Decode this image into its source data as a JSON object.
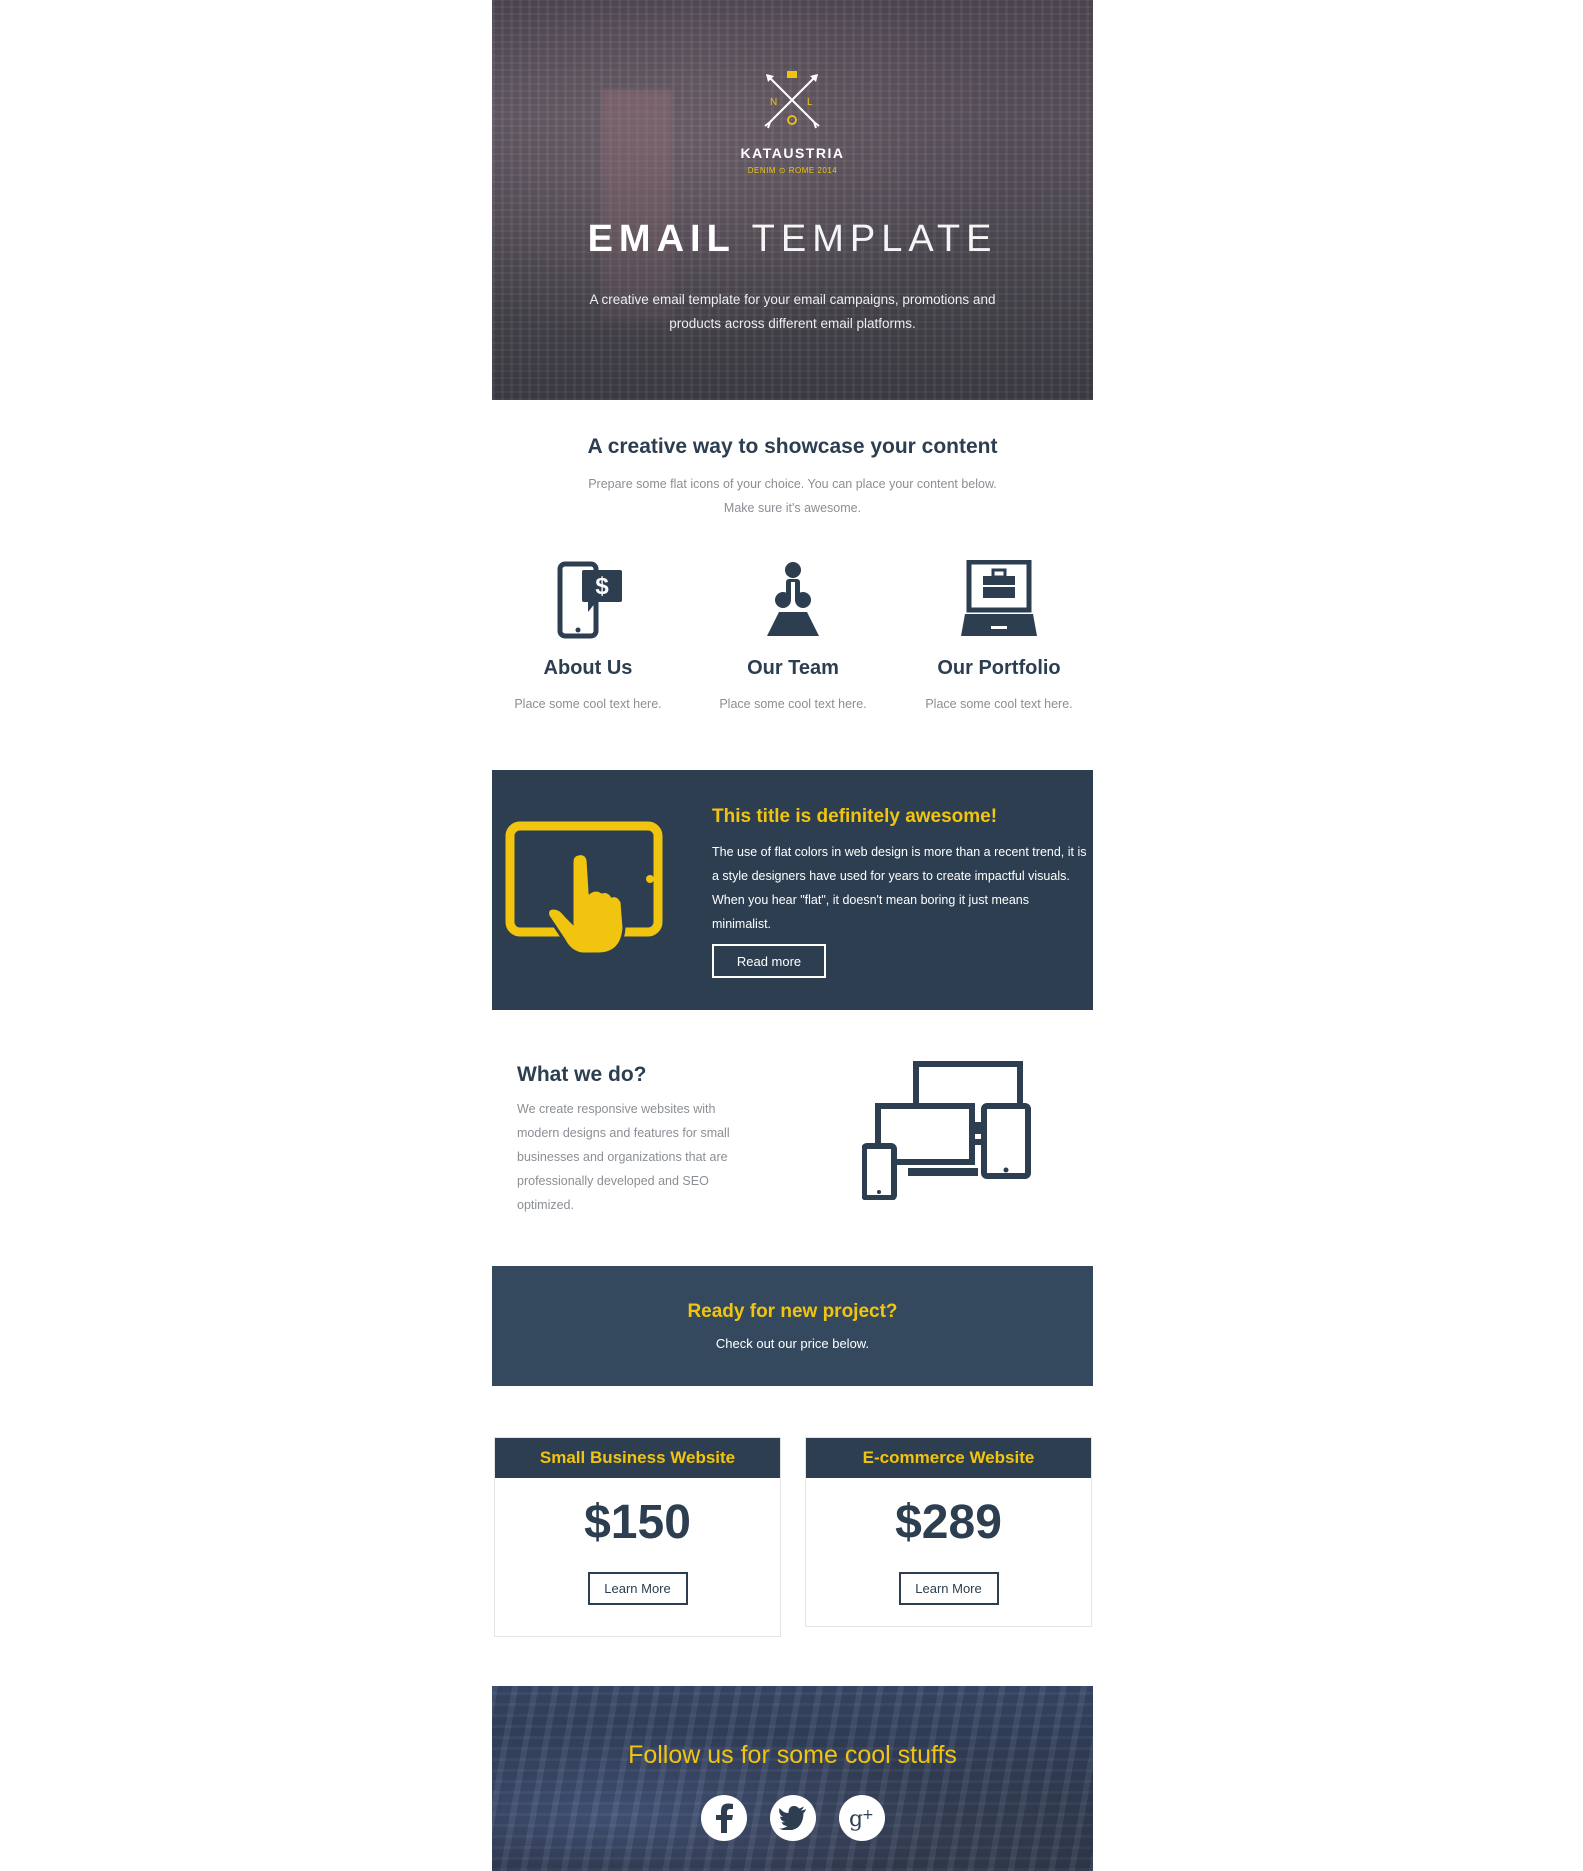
{
  "hero": {
    "brand": "KATAUSTRIA",
    "brand_sub": "DENIM ⊙ ROME 2014",
    "logo_letters": [
      "N",
      "L"
    ],
    "title_bold": "EMAIL",
    "title_light": "TEMPLATE",
    "text": "A creative email template for your email campaigns, promotions and products across different email platforms."
  },
  "intro": {
    "title": "A creative way to showcase your content",
    "text": "Prepare some flat icons of your choice. You can place your content below. Make sure it's awesome."
  },
  "features": [
    {
      "icon": "mobile-dollar-icon",
      "title": "About Us",
      "text": "Place some cool text here."
    },
    {
      "icon": "team-icon",
      "title": "Our Team",
      "text": "Place some cool text here."
    },
    {
      "icon": "portfolio-laptop-icon",
      "title": "Our Portfolio",
      "text": "Place some cool text here."
    }
  ],
  "promo": {
    "title": "This title is definitely awesome!",
    "text": "The use of flat colors in web design is more than a recent trend, it is a style designers have used for years to create impactful visuals. When you hear \"flat\", it doesn't mean boring it just means minimalist.",
    "button": "Read more"
  },
  "what_we_do": {
    "title": "What we do?",
    "text": "We create responsive websites with modern designs and features for small businesses and organizations that are professionally developed and SEO optimized."
  },
  "cta": {
    "title": "Ready for new project?",
    "text": "Check out our price below."
  },
  "pricing": [
    {
      "name": "Small Business Website",
      "price": "$150",
      "button": "Learn More"
    },
    {
      "name": "E-commerce Website",
      "price": "$289",
      "button": "Learn More"
    }
  ],
  "footer": {
    "title": "Follow us for some cool stuffs",
    "social": [
      "facebook-icon",
      "twitter-icon",
      "google-plus-icon"
    ]
  },
  "colors": {
    "dark": "#2c3e50",
    "dark_alt": "#34495e",
    "accent": "#f1c40f",
    "muted_text": "#8a8f95"
  }
}
